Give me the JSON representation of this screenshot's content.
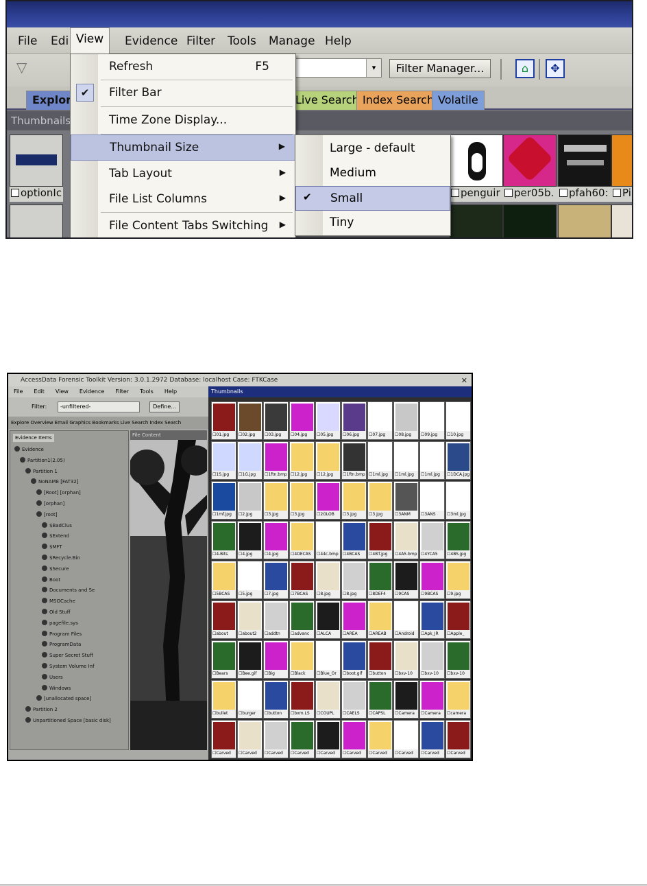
{
  "top": {
    "menubar": {
      "file": "File",
      "edit": "Edi",
      "view": "View",
      "evidence": "Evidence",
      "filter": "Filter",
      "tools": "Tools",
      "manage": "Manage",
      "help": "Help"
    },
    "toolbar": {
      "filter_manager": "Filter Manager...",
      "dropdown_arrow": "▾"
    },
    "tabs": {
      "explore": "Explore",
      "live_search": "Live Search",
      "index_search": "Index Search",
      "volatile": "Volatile"
    },
    "pane_header": "Thumbnails",
    "view_menu": {
      "refresh": "Refresh",
      "refresh_shortcut": "F5",
      "filter_bar": "Filter Bar",
      "time_zone": "Time Zone Display...",
      "thumbnail_size": "Thumbnail Size",
      "tab_layout": "Tab Layout",
      "file_list_columns": "File List Columns",
      "file_content_tabs": "File Content Tabs Switching"
    },
    "size_menu": {
      "large": "Large - default",
      "medium": "Medium",
      "small": "Small",
      "tiny": "Tiny"
    },
    "thumb_labels": {
      "option": "optionIc",
      "penguin": "penguir",
      "per05b": "per05b.",
      "pfah60": "pfah60:",
      "pi": "Pi"
    }
  },
  "bottom": {
    "title": "AccessData Forensic Toolkit Version: 3.0.1.2972 Database: localhost Case: FTKCase",
    "close": "✕",
    "menu": [
      "File",
      "Edit",
      "View",
      "Evidence",
      "Filter",
      "Tools",
      "Help"
    ],
    "filter_label": "Filter:",
    "filter_value": "-unfiltered-",
    "filter_button": "Define...",
    "tabs_text": "Explore  Overview  Email  Graphics  Bookmarks  Live Search  Index Search",
    "tree_header": "Evidence Items",
    "tree": [
      "Evidence",
      "Partition1(2.05)",
      "Partition 1",
      "NoNAME [FAT32]",
      "[Root] [orphan]",
      "[orphan]",
      "[root]",
      "$BadClus",
      "$Extend",
      "$MFT",
      "$Recycle.Bin",
      "$Secure",
      "Boot",
      "Documents and Se",
      "MSOCache",
      "Old Stuff",
      "pagefile.sys",
      "Program Files",
      "ProgramData",
      "Super Secret Stuff",
      "System Volume Inf",
      "Users",
      "Windows",
      "[unallocated space]",
      "Partition 2",
      "Unpartitioned Space [basic disk]"
    ],
    "preview_header": "File Content",
    "grid_header": "Thumbnails",
    "captions": [
      [
        "01.jpg",
        "02.jpg",
        "03.jpg",
        "04.jpg",
        "05.jpg",
        "06.jpg",
        "07.jpg",
        "08.jpg",
        "09.jpg",
        "10.jpg"
      ],
      [
        "1S.jpg",
        "1G.jpg",
        "1ftn.bmp",
        "12.jpg",
        "12.jpg",
        "1ftn.bmp",
        "1ml.jpg",
        "1ml.jpg",
        "1ml.jpg",
        "1DCA.jpg"
      ],
      [
        "1mf.jpg",
        "2.jpg",
        "3.jpg",
        "3.jpg",
        "2GLOB",
        "3.jpg",
        "3.jpg",
        "3ANM",
        "3ANS",
        "3ml.jpg"
      ],
      [
        "4-Bits",
        "4.jpg",
        "4.jpg",
        "4DECAS",
        "44c.bmp",
        "4BCAS",
        "4BT.jpg",
        "4A5.bmp",
        "4YCA5",
        "4BS.jpg"
      ],
      [
        "5BCAS",
        "5.jpg",
        "7.jpg",
        "7BCAS",
        "8.jpg",
        "8.jpg",
        "8DEF4",
        "9CAS",
        "9BCAS",
        "9.jpg"
      ],
      [
        "about",
        "about2",
        "addtn",
        "advanc",
        "ALCA",
        "AREA",
        "AREAB",
        "Android",
        "Apk_JR",
        "Apple_"
      ],
      [
        "Bears",
        "Bee.gif",
        "Big",
        "Black",
        "Blue_Or",
        "boot.gif",
        "button",
        "bxv-10",
        "bxv-10",
        "bxv-10"
      ],
      [
        "bullet",
        "burger",
        "button",
        "bxm.LS",
        "COUPL",
        "CAELS",
        "CAPSL",
        "Camera",
        "Camera",
        "camera"
      ],
      [
        "Carved",
        "Carved",
        "Carved",
        "Carved",
        "Carved",
        "Carved",
        "Carved",
        "Carved",
        "Carved",
        "Carved"
      ]
    ]
  }
}
